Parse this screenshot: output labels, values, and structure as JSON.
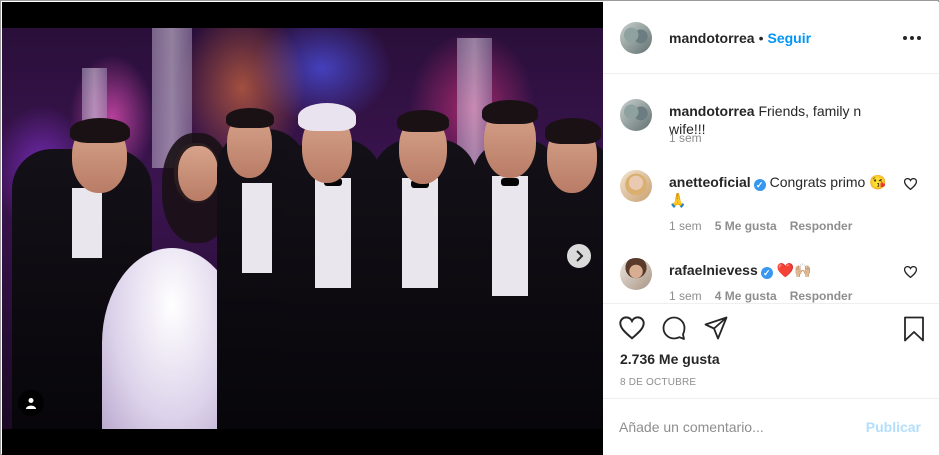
{
  "post": {
    "author": {
      "username": "mandotorrea",
      "separator": "•",
      "follow_label": "Seguir",
      "avatar_icon": "user-avatar"
    },
    "options_icon": "more-horizontal-icon"
  },
  "media": {
    "slides_count": 6,
    "active_slide": 1,
    "next_icon": "chevron-right-icon",
    "tag_icon": "user-tag-icon"
  },
  "comments": [
    {
      "username": "mandotorrea",
      "text": "Friends, family n wife!!!",
      "time": "1 sem",
      "verified": false
    },
    {
      "username": "anetteoficial",
      "text": "Congrats primo 😘🙏",
      "time": "1 sem",
      "likes": "5 Me gusta",
      "reply": "Responder",
      "verified": true
    },
    {
      "username": "rafaelnievess",
      "text": "❤️🙌🏼",
      "time": "1 sem",
      "likes": "4 Me gusta",
      "reply": "Responder",
      "verified": true
    }
  ],
  "actions": {
    "like_icon": "heart-icon",
    "comment_icon": "comment-icon",
    "share_icon": "paper-plane-icon",
    "save_icon": "bookmark-icon"
  },
  "likes_count": "2.736 Me gusta",
  "date": "8 DE OCTUBRE",
  "composer": {
    "placeholder": "Añade un comentario...",
    "publish_label": "Publicar"
  },
  "colors": {
    "accent": "#0095f6",
    "verified": "#3897f0",
    "publish_disabled": "#b2dffc",
    "muted": "#8e8e8e"
  }
}
